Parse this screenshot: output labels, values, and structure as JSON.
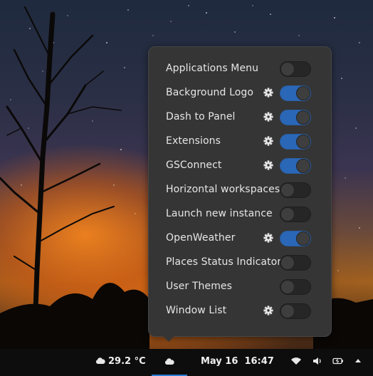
{
  "extensions_menu": {
    "items": [
      {
        "label": "Applications Menu",
        "enabled": false,
        "has_settings": false
      },
      {
        "label": "Background Logo",
        "enabled": true,
        "has_settings": true
      },
      {
        "label": "Dash to Panel",
        "enabled": true,
        "has_settings": true
      },
      {
        "label": "Extensions",
        "enabled": true,
        "has_settings": true
      },
      {
        "label": "GSConnect",
        "enabled": true,
        "has_settings": true
      },
      {
        "label": "Horizontal workspaces",
        "enabled": false,
        "has_settings": false
      },
      {
        "label": "Launch new instance",
        "enabled": false,
        "has_settings": false
      },
      {
        "label": "OpenWeather",
        "enabled": true,
        "has_settings": true
      },
      {
        "label": "Places Status Indicator",
        "enabled": false,
        "has_settings": false
      },
      {
        "label": "User Themes",
        "enabled": false,
        "has_settings": false
      },
      {
        "label": "Window List",
        "enabled": false,
        "has_settings": true
      }
    ]
  },
  "panel": {
    "weather_temp": "29.2 °C",
    "date": "May 16",
    "time": "16:47",
    "icons": [
      "cloud-icon",
      "weather-cloud-icon",
      "wifi-icon",
      "volume-icon",
      "battery-icon",
      "menu-triangle-icon"
    ]
  },
  "colors": {
    "toggle_on": "#2b67b7",
    "popup_bg": "#353535",
    "panel_bg": "#0d0d0d"
  }
}
